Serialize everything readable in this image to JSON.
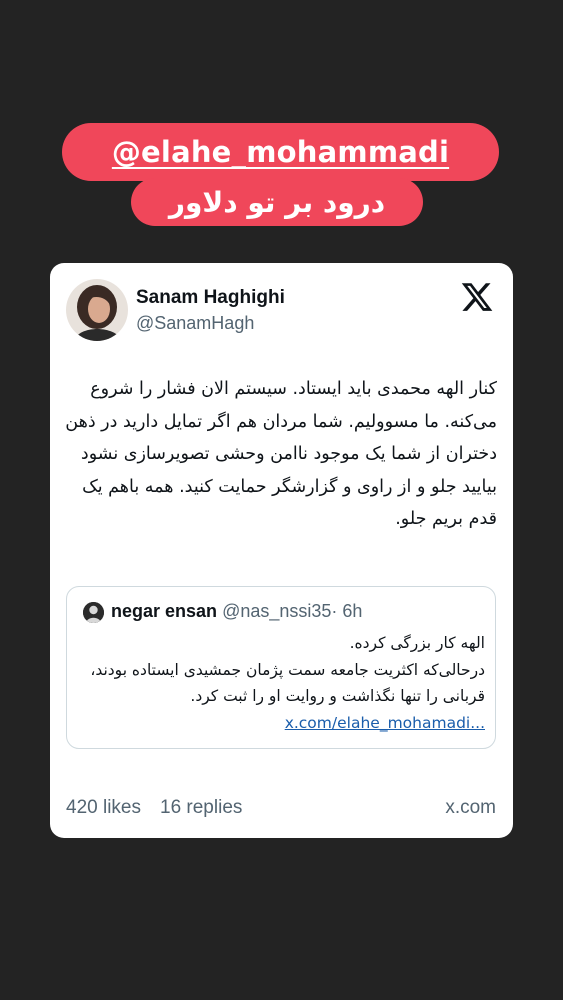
{
  "story": {
    "mention": "@elahe_mohammadi",
    "greeting": "درود بر تو دلاور"
  },
  "tweet": {
    "author_name": "Sanam Haghighi",
    "author_handle": "@SanamHagh",
    "platform_icon": "x-logo-icon",
    "text": "کنار الهه محمدی باید ایستاد. سیستم الان فشار را شروع می‌کنه. ما مسوولیم. شما مردان هم اگر تمایل دارید در ذهن دختران از شما یک موجود ناامن وحشی تصویرسازی نشود بیایید جلو و از راوی و گزارشگر حمایت کنید. همه باهم یک قدم بریم جلو.",
    "quoted": {
      "name": "negar ensan",
      "handle": "@nas_nssi35",
      "time": "· 6h",
      "line1": "الهه کار بزرگی کرده.",
      "line2": "درحالی‌که اکثریت جامعه سمت پژمان جمشیدی ایستاده بودند، قربانی را تنها نگذاشت و روایت او را ثبت کرد.",
      "link": "x.com/elahe_mohamadi..."
    },
    "likes": "420 likes",
    "replies": "16 replies",
    "domain": "x.com"
  },
  "colors": {
    "background": "#232323",
    "sticker": "#f0475a",
    "link": "#1a5dab"
  }
}
